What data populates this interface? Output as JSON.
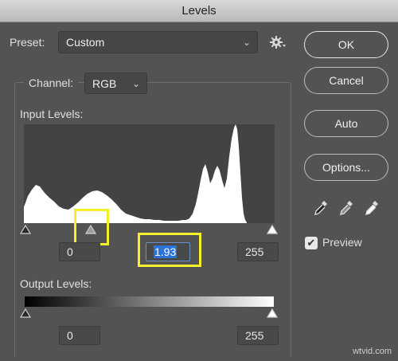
{
  "window": {
    "title": "Levels"
  },
  "preset": {
    "label": "Preset:",
    "value": "Custom"
  },
  "channel": {
    "label": "Channel:",
    "value": "RGB"
  },
  "input_levels": {
    "label": "Input Levels:",
    "black": "0",
    "gamma": "1.93",
    "white": "255"
  },
  "output_levels": {
    "label": "Output Levels:",
    "black": "0",
    "white": "255"
  },
  "buttons": {
    "ok": "OK",
    "cancel": "Cancel",
    "auto": "Auto",
    "options": "Options..."
  },
  "preview": {
    "label": "Preview",
    "checked": true,
    "check_glyph": "✔"
  },
  "watermark": "wtvid.com",
  "colors": {
    "highlight": "#f3ef2a",
    "selection": "#2b73d9",
    "histogram": "#ffffff"
  }
}
